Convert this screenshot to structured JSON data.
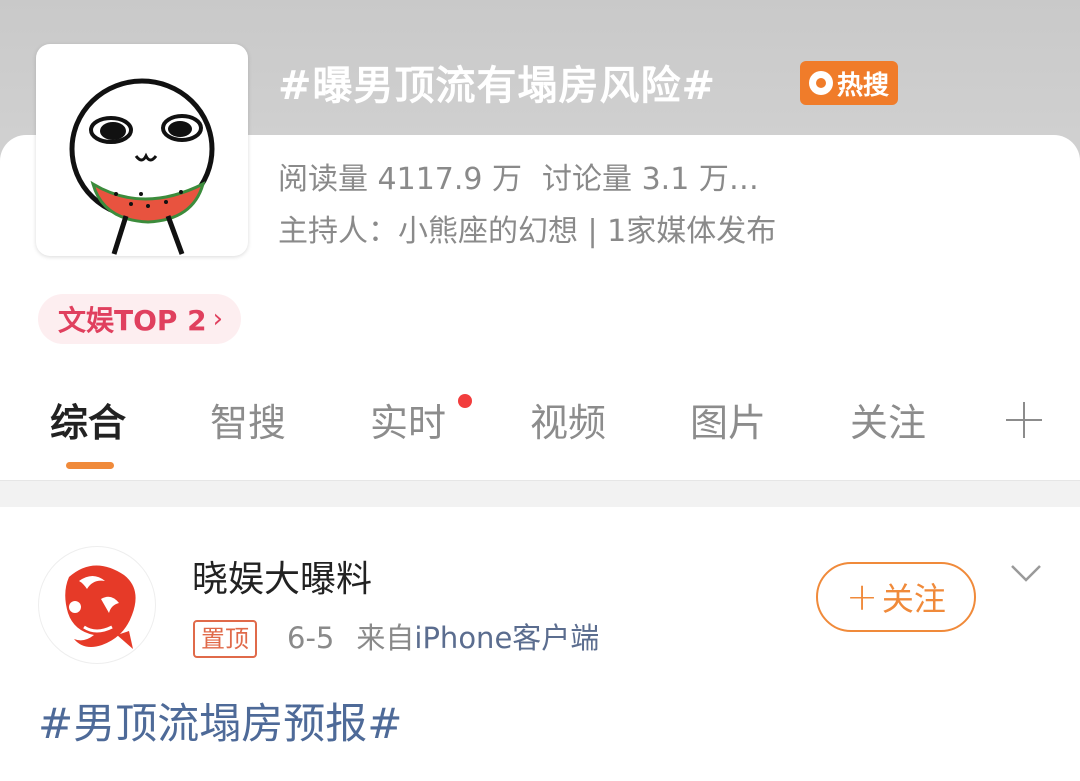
{
  "topic": {
    "title": "#曝男顶流有塌房风险#",
    "hot_badge": "热搜",
    "stats": {
      "reads": "阅读量 4117.9 万",
      "discussions": "讨论量 3.1 万…"
    },
    "host_line": "主持人：小熊座的幻想 | 1家媒体发布",
    "rank_label": "文娱TOP 2",
    "rank_chevron": "›"
  },
  "tabs": [
    {
      "label": "综合",
      "active": true
    },
    {
      "label": "智搜",
      "active": false
    },
    {
      "label": "实时",
      "active": false,
      "dot": true
    },
    {
      "label": "视频",
      "active": false
    },
    {
      "label": "图片",
      "active": false
    },
    {
      "label": "关注",
      "active": false
    }
  ],
  "post": {
    "author": "晓娱大曝料",
    "pin_badge": "置顶",
    "date": "6-5",
    "source_prefix": "来自",
    "source_client": "iPhone客户端",
    "follow_label": "关注",
    "follow_plus": "+",
    "text": "#男顶流塌房预报#"
  },
  "colors": {
    "accent_orange": "#f08a3a",
    "hot_badge": "#f07c2a",
    "rank_pink": "#e0405e",
    "link_blue": "#4e6a98",
    "notification_dot": "#f23d3d"
  },
  "icons": {
    "topic_avatar": "cartoon-face-eating-watermelon",
    "post_avatar": "red-koi-fish-emblem",
    "more_tabs": "plus-icon",
    "post_menu": "chevron-down-icon"
  }
}
